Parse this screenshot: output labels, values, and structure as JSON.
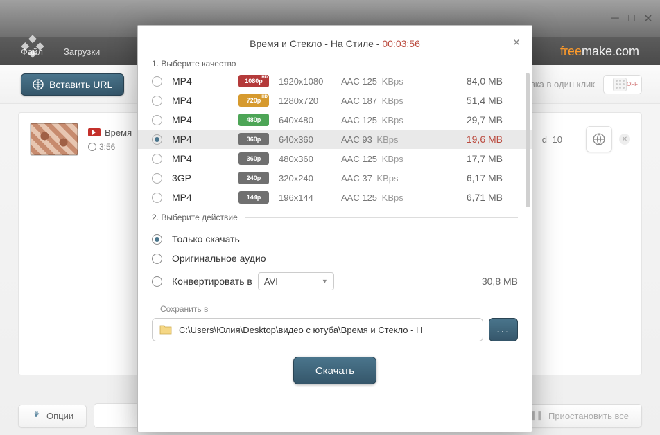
{
  "window": {
    "title": ""
  },
  "menubar": {
    "file": "Файл",
    "downloads": "Загрузки"
  },
  "brand": {
    "free": "free",
    "make": "make",
    "dom": ".com"
  },
  "toolbar": {
    "paste_url": "Вставить URL",
    "one_click_hint": "узка в один клик",
    "switch_off": "OFF"
  },
  "item": {
    "title": "Время",
    "duration": "3:56",
    "tail": "d=10"
  },
  "bottom": {
    "options": "Опции",
    "pause_all": "Приостановить все"
  },
  "modal": {
    "title_prefix": "Время и Стекло - На Стиле - ",
    "title_duration": "00:03:56",
    "section1": "1. Выберите качество",
    "section2": "2. Выберите действие",
    "qualities": [
      {
        "fmt": "MP4",
        "badge": "1080p",
        "bclass": "b1080",
        "hd": true,
        "res": "1920x1080",
        "aac": "AAC 125",
        "kbps": "KBps",
        "size": "84,0 MB",
        "sel": false,
        "apple": false
      },
      {
        "fmt": "MP4",
        "badge": "720p",
        "bclass": "b720",
        "hd": true,
        "res": "1280x720",
        "aac": "AAC 187",
        "kbps": "KBps",
        "size": "51,4 MB",
        "sel": false,
        "apple": false
      },
      {
        "fmt": "MP4",
        "badge": "480p",
        "bclass": "b480",
        "hd": false,
        "res": "640x480",
        "aac": "AAC 125",
        "kbps": "KBps",
        "size": "29,7 MB",
        "sel": false,
        "apple": false
      },
      {
        "fmt": "MP4",
        "badge": "360p",
        "bclass": "b360",
        "hd": false,
        "res": "640x360",
        "aac": "AAC 93",
        "kbps": "KBps",
        "size": "19,6 MB",
        "sel": true,
        "apple": true
      },
      {
        "fmt": "MP4",
        "badge": "360p",
        "bclass": "b360",
        "hd": false,
        "res": "480x360",
        "aac": "AAC 125",
        "kbps": "KBps",
        "size": "17,7 MB",
        "sel": false,
        "apple": false
      },
      {
        "fmt": "3GP",
        "badge": "240p",
        "bclass": "b240",
        "hd": false,
        "res": "320x240",
        "aac": "AAC 37",
        "kbps": "KBps",
        "size": "6,17 MB",
        "sel": false,
        "apple": false
      },
      {
        "fmt": "MP4",
        "badge": "144p",
        "bclass": "b144",
        "hd": false,
        "res": "196x144",
        "aac": "AAC 125",
        "kbps": "KBps",
        "size": "6,71 MB",
        "sel": false,
        "apple": false
      }
    ],
    "action_download_only": "Только скачать",
    "action_original_audio": "Оригинальное аудио",
    "action_convert_to": "Конвертировать в",
    "convert_format": "AVI",
    "convert_size": "30,8 MB",
    "save_label": "Сохранить в",
    "save_path": "C:\\Users\\Юлия\\Desktop\\видео с ютуба\\Время и Стекло - Н",
    "browse": "...",
    "download_btn": "Скачать"
  }
}
